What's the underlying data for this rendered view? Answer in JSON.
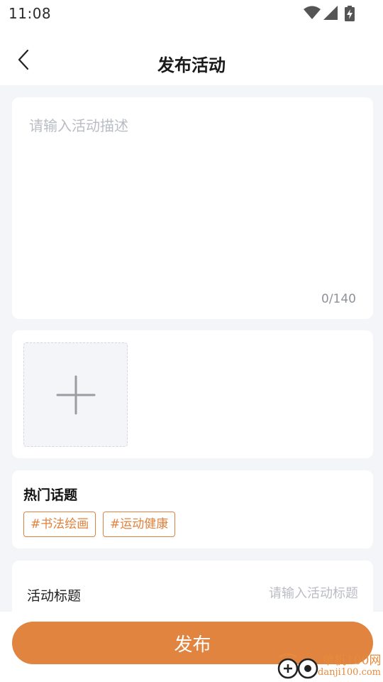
{
  "status_bar": {
    "time": "11:08",
    "icons": [
      "wifi-icon",
      "cellular-signal-icon",
      "battery-charging-icon"
    ]
  },
  "header": {
    "back_icon": "chevron-left-icon",
    "title": "发布活动"
  },
  "description": {
    "placeholder": "请输入活动描述",
    "value": "",
    "counter": "0/140"
  },
  "photos": {
    "add_icon": "plus-icon"
  },
  "topics": {
    "title": "热门话题",
    "tags": [
      "#书法绘画",
      "#运动健康"
    ]
  },
  "activity_title": {
    "label": "活动标题",
    "placeholder": "请输入活动标题",
    "value": ""
  },
  "footer": {
    "publish_label": "发布"
  },
  "watermark": {
    "name": "单机100网",
    "url": "danji100.com"
  },
  "colors": {
    "accent": "#e0843f",
    "background": "#f4f5f9",
    "card": "#ffffff",
    "placeholder": "#b9bcc4"
  }
}
